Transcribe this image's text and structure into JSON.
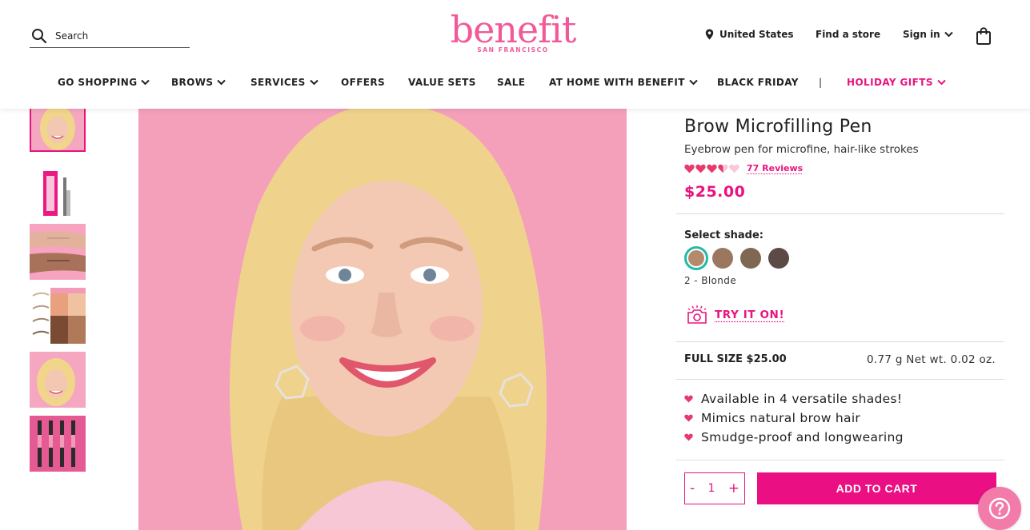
{
  "header": {
    "search_placeholder": "Search",
    "logo_word": "benefit",
    "logo_sub": "SAN FRANCISCO",
    "location": "United States",
    "find_store": "Find a store",
    "sign_in": "Sign in"
  },
  "nav": [
    {
      "label": "GO SHOPPING",
      "has_chevron": true
    },
    {
      "label": "BROWS",
      "has_chevron": true
    },
    {
      "label": "SERVICES",
      "has_chevron": true
    },
    {
      "label": "OFFERS",
      "has_chevron": false
    },
    {
      "label": "VALUE SETS",
      "has_chevron": false
    },
    {
      "label": "SALE",
      "has_chevron": false
    },
    {
      "label": "AT HOME WITH BENEFIT",
      "has_chevron": true
    },
    {
      "label": "BLACK FRIDAY",
      "has_chevron": false
    },
    {
      "label": "|",
      "has_chevron": false
    },
    {
      "label": "HOLIDAY GIFTS",
      "has_chevron": true
    }
  ],
  "thumbnails": [
    "model-portrait",
    "product-packaging",
    "arm-swatches",
    "brow-shapes-collage",
    "model-portrait-2",
    "pens-lineup"
  ],
  "product": {
    "title": "Brow Microfilling Pen",
    "subtitle": "Eyebrow pen for microfine, hair-like strokes",
    "rating": 3.5,
    "reviews": "77 Reviews",
    "price": "$25.00",
    "select_shade_label": "Select shade:",
    "shades": [
      "#b58a6c",
      "#9c7760",
      "#7e6851",
      "#5b4a46"
    ],
    "selected_shade": "2 - Blonde",
    "try_on": "TRY IT ON!",
    "full_size": "FULL SIZE $25.00",
    "net_wt": "0.77 g Net wt. 0.02 oz.",
    "bullets": [
      "Available in 4 versatile shades!",
      "Mimics natural brow hair",
      "Smudge-proof and longwearing"
    ],
    "qty_minus": "-",
    "quantity": "1",
    "qty_plus": "+",
    "add_to_cart": "ADD TO CART"
  },
  "colors": {
    "brand_pink": "#e8137f",
    "logo_pink": "#f15a99",
    "selected_ring": "#26b8a8",
    "heart": "#e8396e"
  }
}
